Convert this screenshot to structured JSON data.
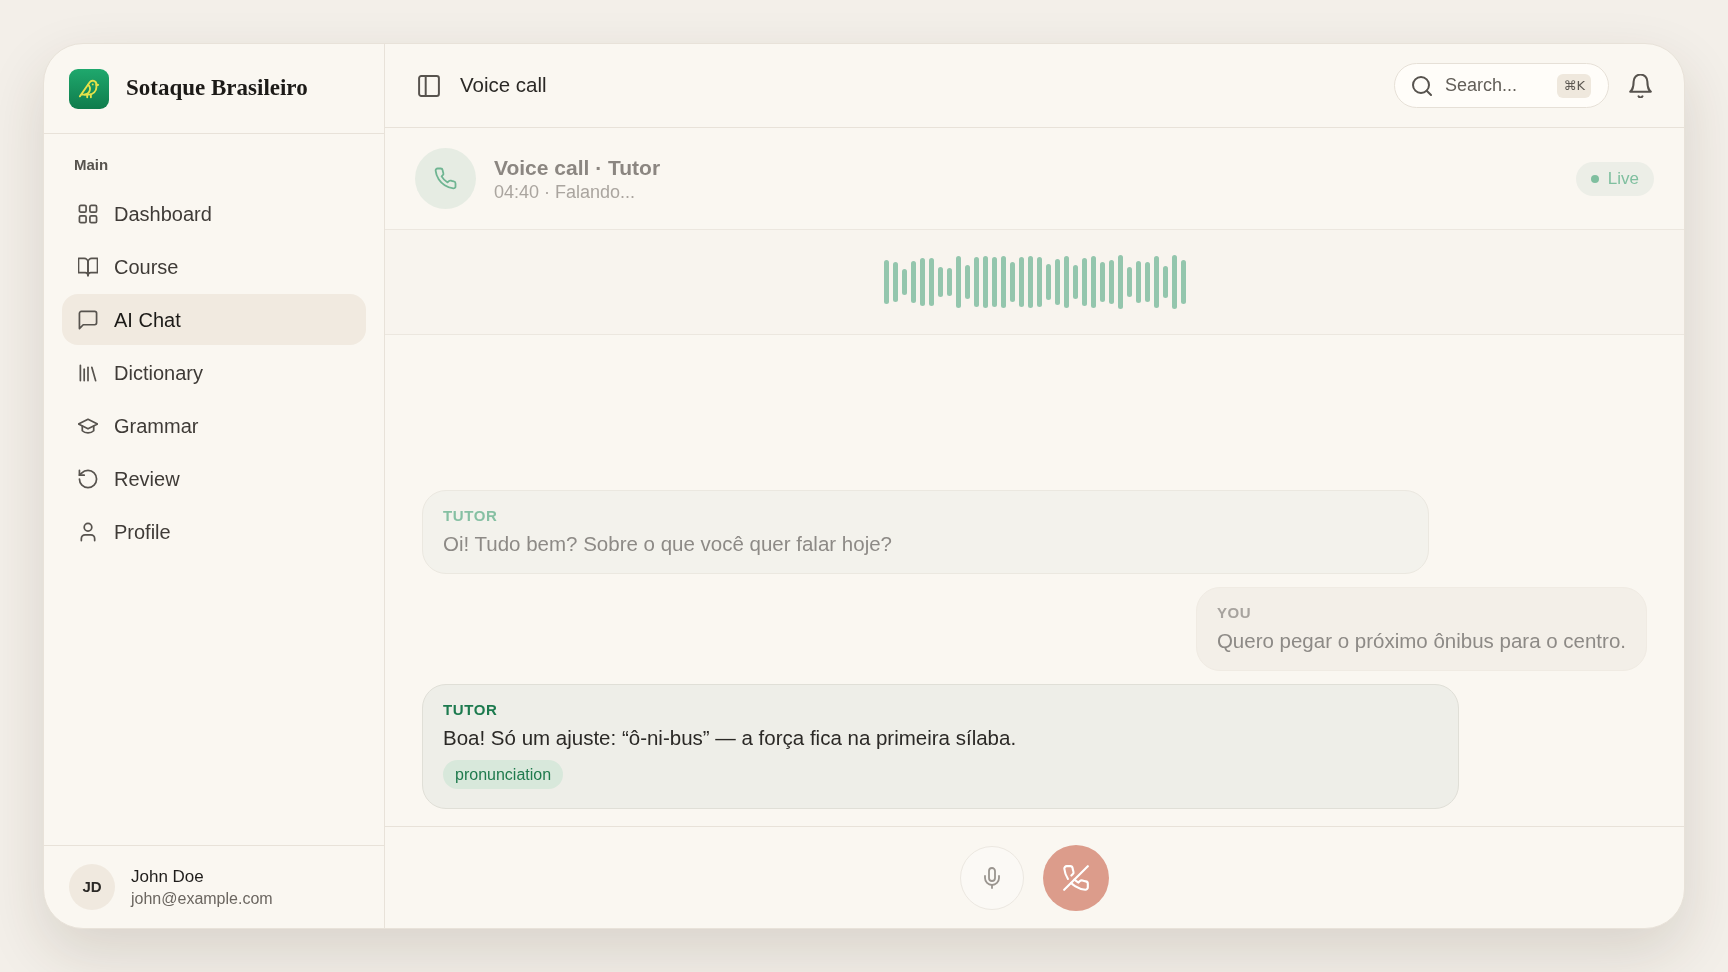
{
  "app": {
    "name": "Sotaque Brasileiro"
  },
  "sidebar": {
    "section_label": "Main",
    "items": [
      {
        "label": "Dashboard",
        "selected": false
      },
      {
        "label": "Course",
        "selected": false
      },
      {
        "label": "AI Chat",
        "selected": true
      },
      {
        "label": "Dictionary",
        "selected": false
      },
      {
        "label": "Grammar",
        "selected": false
      },
      {
        "label": "Review",
        "selected": false
      },
      {
        "label": "Profile",
        "selected": false
      }
    ]
  },
  "user": {
    "initials": "JD",
    "name": "John Doe",
    "email": "john@example.com"
  },
  "header": {
    "title": "Voice call",
    "search": {
      "placeholder": "Search...",
      "shortcut": "⌘K"
    }
  },
  "call": {
    "title": "Voice call · Tutor",
    "subtitle": "04:40 · Falando...",
    "status": "Live"
  },
  "messages": [
    {
      "kind": "tutor",
      "speaker": "TUTOR",
      "text": "Oi! Tudo bem? Sobre o que você quer falar hoje?",
      "current": false
    },
    {
      "kind": "user",
      "speaker": "YOU",
      "text": "Quero pegar o próximo ônibus para o centro.",
      "current": false
    },
    {
      "kind": "tutor",
      "speaker": "TUTOR",
      "text": "Boa! Só um ajuste: “ô-ni-bus” — a força fica na primeira sílaba.",
      "current": true,
      "tags": [
        "pronunciation"
      ]
    }
  ]
}
